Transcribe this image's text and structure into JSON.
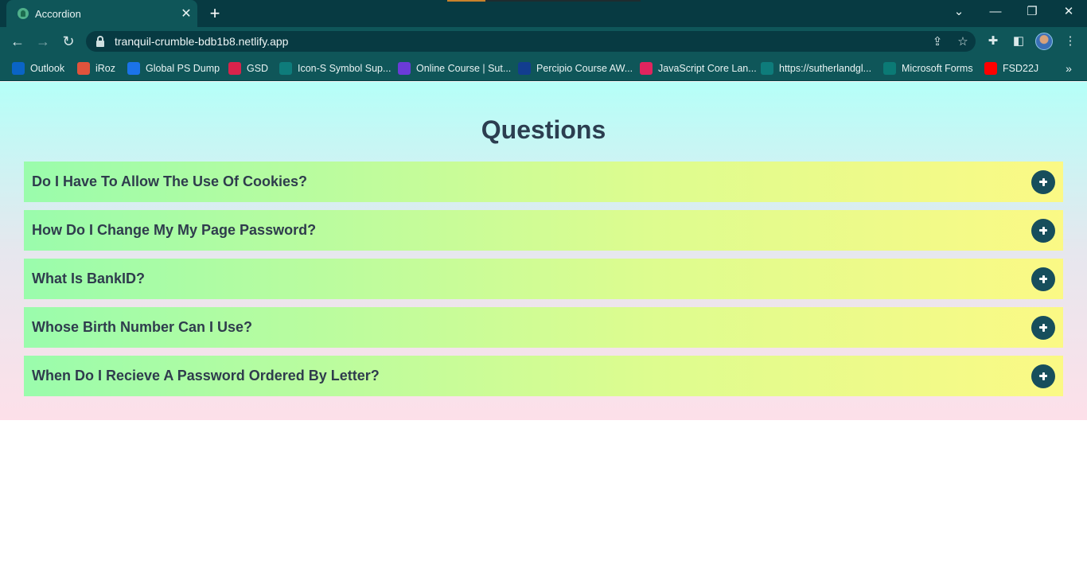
{
  "browser": {
    "tab_title": "Accordion",
    "tab_close": "✕",
    "new_tab": "+",
    "window_controls": {
      "tabs_menu": "⌄",
      "minimize": "—",
      "restore": "❐",
      "close": "✕"
    },
    "nav": {
      "back": "←",
      "forward": "→",
      "reload": "↻"
    },
    "url": "tranquil-crumble-bdb1b8.netlify.app",
    "omnibox_icons": {
      "share": "⇪",
      "bookmark": "☆"
    },
    "toolbar_icons": {
      "extensions": "✚",
      "side_panel": "◧",
      "menu": "⋮"
    },
    "bookmarks": [
      {
        "label": "Outlook",
        "icon": "outlook-icon",
        "color": "#0a64c6"
      },
      {
        "label": "iRoz",
        "icon": "iroz-icon",
        "color": "#e0533c"
      },
      {
        "label": "Global PS Dump",
        "icon": "global-ps-icon",
        "color": "#1b73e8"
      },
      {
        "label": "GSD",
        "icon": "gsd-icon",
        "color": "#d8234b"
      },
      {
        "label": "Icon-S Symbol Sup...",
        "icon": "sharepoint-icon",
        "color": "#0e7c7b"
      },
      {
        "label": "Online Course | Sut...",
        "icon": "course-icon",
        "color": "#6a3bd8"
      },
      {
        "label": "Percipio Course AW...",
        "icon": "percipio-icon",
        "color": "#123d8f"
      },
      {
        "label": "JavaScript Core Lan...",
        "icon": "javascript-icon",
        "color": "#e0245e"
      },
      {
        "label": "https://sutherlandgl...",
        "icon": "sharepoint-icon",
        "color": "#0e7c7b"
      },
      {
        "label": "Microsoft Forms",
        "icon": "forms-icon",
        "color": "#0b7a75"
      },
      {
        "label": "FSD22J",
        "icon": "youtube-icon",
        "color": "#ff0000"
      }
    ],
    "bookmarks_overflow": "»"
  },
  "page": {
    "title": "Questions",
    "questions": [
      "Do I Have To Allow The Use Of Cookies?",
      "How Do I Change My My Page Password?",
      "What Is BankID?",
      "Whose Birth Number Can I Use?",
      "When Do I Recieve A Password Ordered By Letter?"
    ]
  },
  "colors": {
    "chrome_dark": "#073a42",
    "chrome": "#0f5659",
    "heading": "#2c3e50",
    "plus_button": "#174e5c"
  }
}
